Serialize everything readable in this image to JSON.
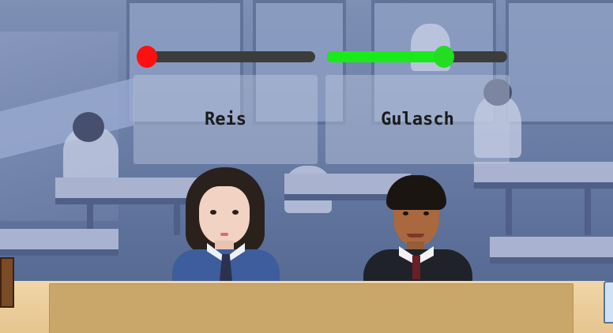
{
  "meters": {
    "left": {
      "level": 0.05,
      "fill_color": "#ff1a1a",
      "knob_color": "#ff1010"
    },
    "right": {
      "level": 0.65,
      "fill_color": "#1aea1a",
      "knob_color": "#22dd22"
    }
  },
  "choices": [
    {
      "label": "Reis"
    },
    {
      "label": "Gulasch"
    }
  ],
  "dialog": {
    "text": ""
  }
}
